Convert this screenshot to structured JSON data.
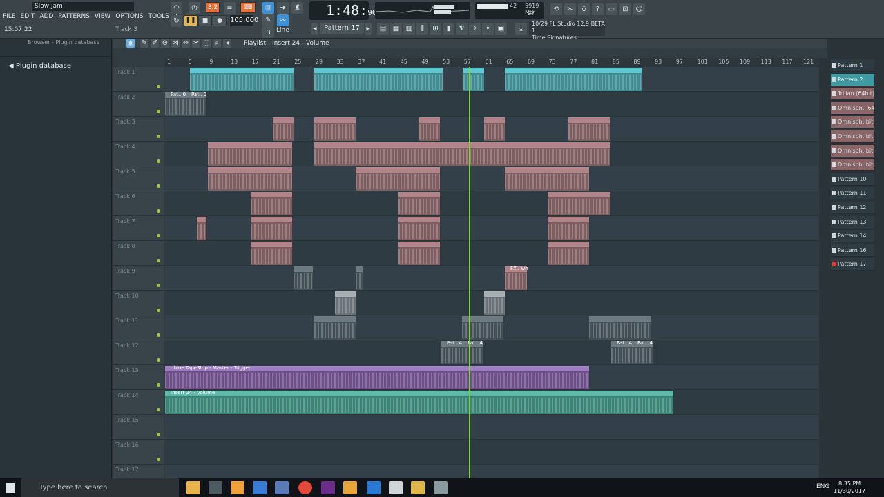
{
  "app": {
    "song_title": "Slow jam",
    "menu": [
      "FILE",
      "EDIT",
      "ADD",
      "PATTERNS",
      "VIEW",
      "OPTIONS",
      "TOOLS",
      "?"
    ],
    "hint_time": "15:07:22",
    "hint_track": "Track 3",
    "clock_main": "1:48",
    "clock_sub": "96",
    "tempo": "105.000",
    "snap_mode": "Line",
    "pattern_selector": "Pattern 17",
    "btn_32": "3.2",
    "cpu_value": "42",
    "mem_value": "5919 MB",
    "poly_value": "27",
    "cpu_fraction": 0.45,
    "hint_line1": "10/29  FL Studio 12.9 BETA 1",
    "hint_line2": "Time Signatures"
  },
  "browser": {
    "header": "Browser - Plugin database",
    "item": "Plugin database"
  },
  "playlist": {
    "title": "Playlist - Insert 24 - Volume",
    "ruler": [
      "1",
      "5",
      "9",
      "13",
      "17",
      "21",
      "25",
      "29",
      "33",
      "37",
      "41",
      "45",
      "49",
      "53",
      "57",
      "61",
      "65",
      "69",
      "73",
      "77",
      "81",
      "85",
      "89",
      "93",
      "97",
      "101",
      "105",
      "109",
      "113",
      "117",
      "121"
    ],
    "tracks": [
      "Track 1",
      "Track 2",
      "Track 3",
      "Track 4",
      "Track 5",
      "Track 6",
      "Track 7",
      "Track 8",
      "Track 9",
      "Track 10",
      "Track 11",
      "Track 12",
      "Track 13",
      "Track 14",
      "Track 15",
      "Track 16",
      "Track 17"
    ],
    "clip_labels": {
      "pat0a": "Pat.. 0",
      "pat0b": "Pat.. 0",
      "fxwh": "FX.. wh",
      "pat4a": "Pat.. 4",
      "pat4b": "Pat.. 4",
      "pat4c": "Pat.. 4",
      "pat4d": "Pat.. 4",
      "tapestop": "dblue.TapeStop - Master - Trigger",
      "insert24": "Insert 24 - Volume"
    }
  },
  "patterns": [
    {
      "label": "Pattern 1",
      "kind": "normal"
    },
    {
      "label": "Pattern 2",
      "kind": "active"
    },
    {
      "label": "Trilian (64bit)",
      "kind": "plugin"
    },
    {
      "label": "Omnisph.. 64bit",
      "kind": "plugin"
    },
    {
      "label": "Omnisph..bit) #2",
      "kind": "plugin"
    },
    {
      "label": "Omnisph..bit) #3",
      "kind": "plugin"
    },
    {
      "label": "Omnisph..bit) #4",
      "kind": "plugin"
    },
    {
      "label": "Omnisph..bit) #5",
      "kind": "plugin"
    },
    {
      "label": "Pattern 10",
      "kind": "normal"
    },
    {
      "label": "Pattern 11",
      "kind": "normal"
    },
    {
      "label": "Pattern 12",
      "kind": "normal"
    },
    {
      "label": "Pattern 13",
      "kind": "normal"
    },
    {
      "label": "Pattern 14",
      "kind": "normal"
    },
    {
      "label": "Pattern 16",
      "kind": "normal"
    },
    {
      "label": "Pattern 17",
      "kind": "selected"
    }
  ],
  "taskbar": {
    "search_placeholder": "Type here to search",
    "lang": "ENG",
    "time": "8:35 PM",
    "date": "11/30/2017"
  }
}
